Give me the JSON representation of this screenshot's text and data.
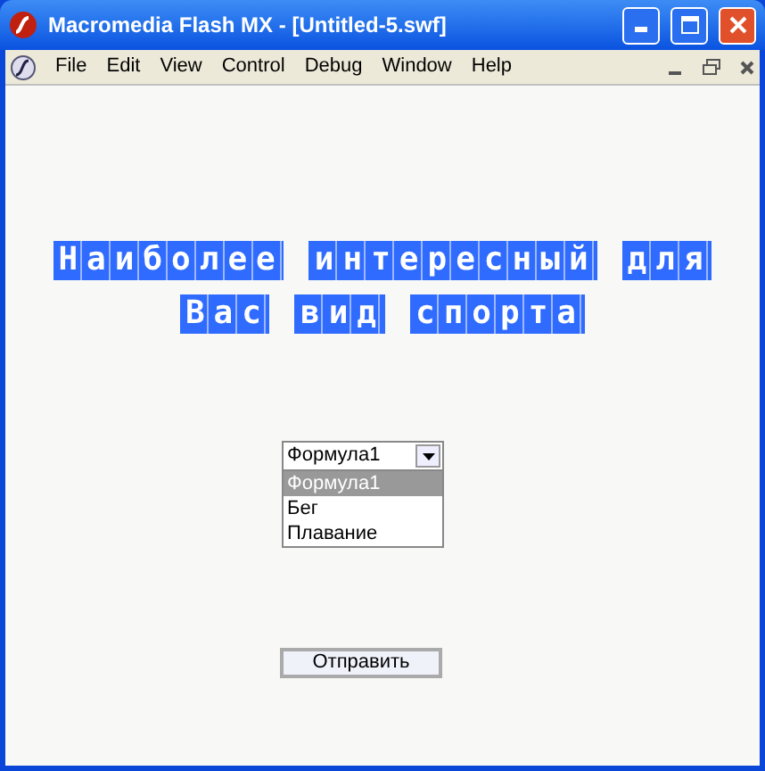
{
  "window": {
    "title": "Macromedia Flash MX - [Untitled-5.swf]"
  },
  "menu": [
    "File",
    "Edit",
    "View",
    "Control",
    "Debug",
    "Window",
    "Help"
  ],
  "heading": [
    "Наиболее интересный для",
    "Вас вид спорта"
  ],
  "dropdown": {
    "value": "Формула1",
    "expanded": true,
    "options": [
      {
        "label": "Формула1",
        "selected": true
      },
      {
        "label": "Бег",
        "selected": false
      },
      {
        "label": "Плавание",
        "selected": false
      }
    ]
  },
  "submit": "Отправить"
}
